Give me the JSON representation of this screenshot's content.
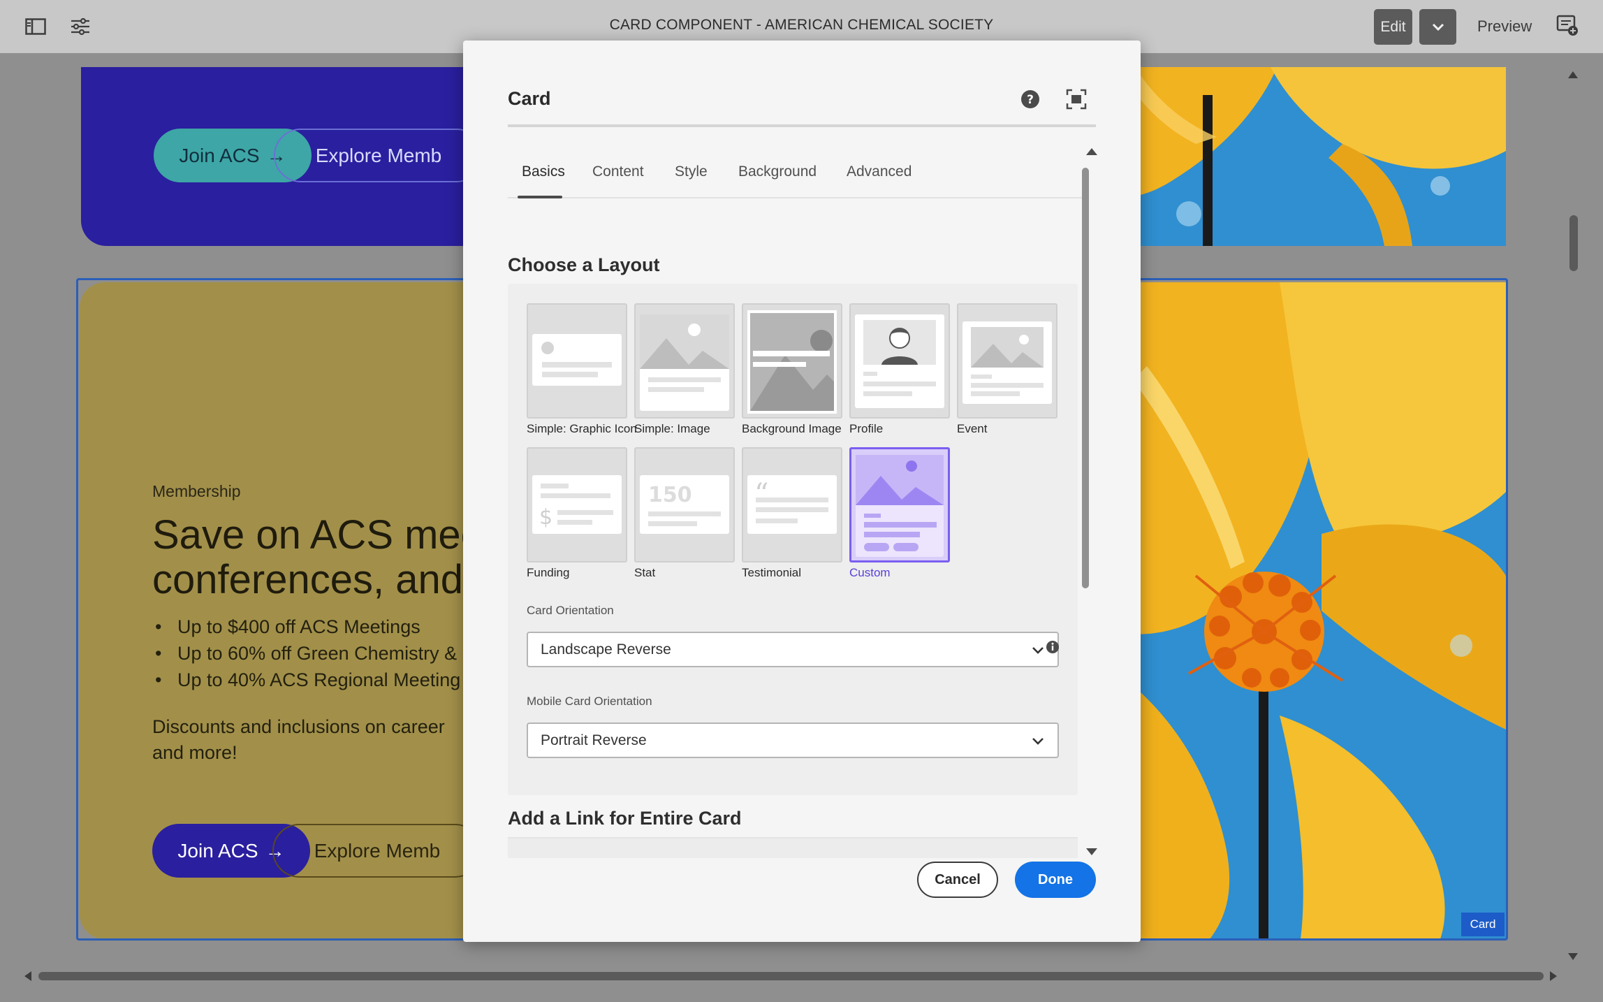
{
  "toolbar": {
    "title": "CARD COMPONENT - AMERICAN CHEMICAL SOCIETY",
    "edit_label": "Edit",
    "preview_label": "Preview",
    "icons": [
      "sidebar-toggle-icon",
      "properties-sliders-icon",
      "chevron-down-icon",
      "annotations-icon"
    ]
  },
  "page": {
    "top_card": {
      "primary_button": "Join ACS",
      "secondary_button": "Explore Memb",
      "background_color": "#2a1f9e"
    },
    "membership_card": {
      "eyebrow": "Membership",
      "heading_line1": "Save on ACS mee",
      "heading_line2": "conferences, and",
      "bullets": [
        "Up to $400 off ACS Meetings",
        "Up to 60% off Green Chemistry &",
        "Up to 40% ACS Regional Meeting"
      ],
      "body_line1": "Discounts and inclusions on career",
      "body_line2": "and more!",
      "primary_button": "Join ACS",
      "secondary_button": "Explore Memb",
      "background_color": "#a2904a"
    },
    "selected_component_tag": "Card"
  },
  "dialog": {
    "title": "Card",
    "tabs": [
      {
        "label": "Basics",
        "active": true
      },
      {
        "label": "Content",
        "active": false
      },
      {
        "label": "Style",
        "active": false
      },
      {
        "label": "Background",
        "active": false
      },
      {
        "label": "Advanced",
        "active": false
      }
    ],
    "layout_section_title": "Choose a Layout",
    "layouts": [
      {
        "label": "Simple: Graphic Icon",
        "selected": false
      },
      {
        "label": "Simple: Image",
        "selected": false
      },
      {
        "label": "Background Image",
        "selected": false
      },
      {
        "label": "Profile",
        "selected": false
      },
      {
        "label": "Event",
        "selected": false
      },
      {
        "label": "Funding",
        "selected": false
      },
      {
        "label": "Stat",
        "selected": false
      },
      {
        "label": "Testimonial",
        "selected": false
      },
      {
        "label": "Custom",
        "selected": true
      }
    ],
    "stat_tile_number": "150",
    "funding_tile_symbol": "$",
    "testimonial_tile_mark": "“",
    "card_orientation": {
      "label": "Card Orientation",
      "value": "Landscape Reverse"
    },
    "mobile_card_orientation": {
      "label": "Mobile Card Orientation",
      "value": "Portrait Reverse"
    },
    "link_section_title": "Add a Link for Entire Card",
    "cancel_label": "Cancel",
    "done_label": "Done",
    "accent_color": "#1473e6",
    "selected_color": "#7b5ef0"
  }
}
